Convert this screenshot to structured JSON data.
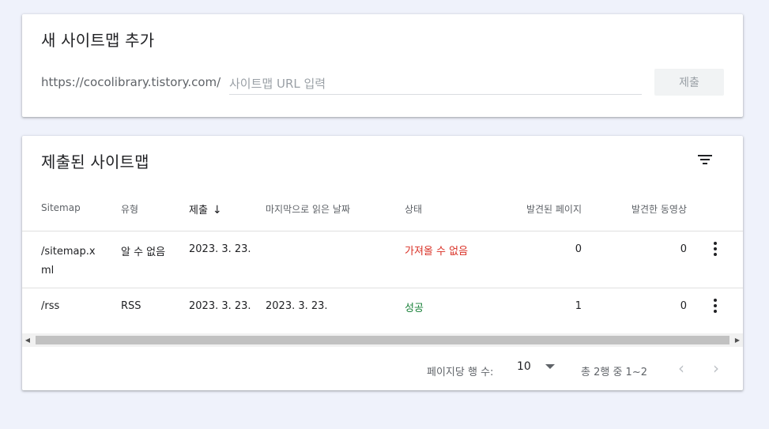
{
  "add": {
    "title": "새 사이트맵 추가",
    "prefix": "https://cocolibrary.tistory.com/",
    "placeholder": "사이트맵 URL 입력",
    "submit": "제출"
  },
  "list": {
    "title": "제출된 사이트맵",
    "columns": {
      "sitemap": "Sitemap",
      "type": "유형",
      "submitted": "제출",
      "last_read": "마지막으로 읽은 날짜",
      "status": "상태",
      "pages": "발견된 페이지",
      "videos": "발견한 동영상"
    },
    "rows": [
      {
        "sitemap_line1": "/sitemap.x",
        "sitemap_line2": "ml",
        "type": "알 수 없음",
        "submitted": "2023. 3. 23.",
        "last_read": "",
        "status": "가져올 수 없음",
        "pages": "0",
        "videos": "0"
      },
      {
        "sitemap_line1": "/rss",
        "sitemap_line2": "",
        "type": "RSS",
        "submitted": "2023. 3. 23.",
        "last_read": "2023. 3. 23.",
        "status": "성공",
        "pages": "1",
        "videos": "0"
      }
    ],
    "pagination": {
      "rows_label": "페이지당 행 수:",
      "rows_value": "10",
      "range": "총 2행 중 1~2"
    }
  },
  "colors": {
    "error": "#d93025",
    "success": "#188038",
    "background": "#eff2fb"
  }
}
